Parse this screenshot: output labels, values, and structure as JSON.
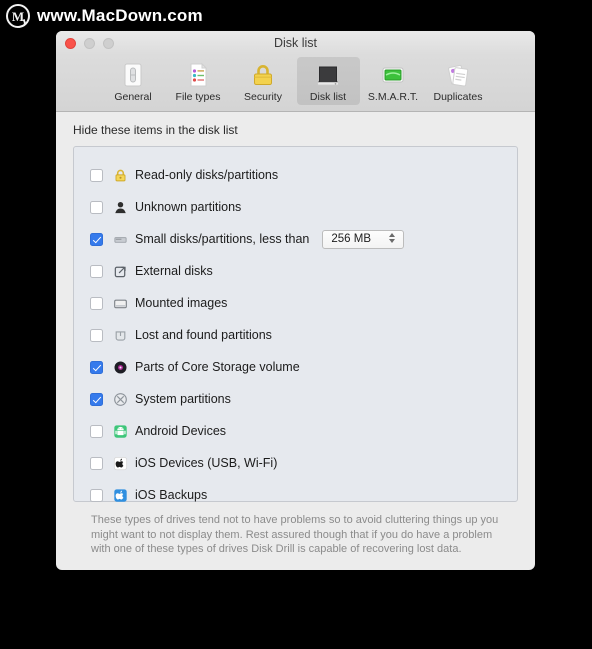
{
  "watermark": {
    "logo_letter": "M",
    "text": "www.MacDown.com"
  },
  "window": {
    "title": "Disk list",
    "traffic_lights": [
      "close-button",
      "minimize-button",
      "maximize-button"
    ]
  },
  "toolbar": {
    "items": [
      {
        "label": "General",
        "icon": "general-switch-icon",
        "selected": false
      },
      {
        "label": "File types",
        "icon": "file-types-doc-icon",
        "selected": false
      },
      {
        "label": "Security",
        "icon": "security-lock-icon",
        "selected": false
      },
      {
        "label": "Disk list",
        "icon": "disk-list-drive-icon",
        "selected": true
      },
      {
        "label": "S.M.A.R.T.",
        "icon": "smart-monitor-icon",
        "selected": false
      },
      {
        "label": "Duplicates",
        "icon": "duplicates-docs-icon",
        "selected": false
      }
    ]
  },
  "main": {
    "section_heading": "Hide these items in the disk list",
    "rows": [
      {
        "label": "Read-only disks/partitions",
        "checked": false,
        "icon": "padlock-icon"
      },
      {
        "label": "Unknown partitions",
        "checked": false,
        "icon": "person-silhouette-icon"
      },
      {
        "label": "Small disks/partitions, less than",
        "checked": true,
        "icon": "small-disk-icon",
        "stepper": true
      },
      {
        "label": "External disks",
        "checked": false,
        "icon": "external-arrow-icon"
      },
      {
        "label": "Mounted images",
        "checked": false,
        "icon": "mounted-image-icon"
      },
      {
        "label": "Lost and found partitions",
        "checked": false,
        "icon": "lost-found-icon"
      },
      {
        "label": "Parts of Core Storage volume",
        "checked": true,
        "icon": "core-storage-icon"
      },
      {
        "label": "System partitions",
        "checked": true,
        "icon": "system-partition-icon"
      },
      {
        "label": "Android Devices",
        "checked": false,
        "icon": "android-icon"
      },
      {
        "label": "iOS Devices (USB, Wi-Fi)",
        "checked": false,
        "icon": "apple-black-icon"
      },
      {
        "label": "iOS Backups",
        "checked": false,
        "icon": "apple-blue-icon"
      }
    ],
    "size_stepper": {
      "value": "256 MB"
    },
    "footnote": "These types of drives tend not to have problems so to avoid cluttering things up you might want to not display them. Rest assured though that if you do have a problem with one of these types of drives Disk Drill is capable of recovering lost data."
  },
  "colors": {
    "accent_checkbox": "#357aec",
    "window_bg": "#ececec",
    "panel_bg": "#e6e9ee",
    "close_red": "#f9524a"
  }
}
